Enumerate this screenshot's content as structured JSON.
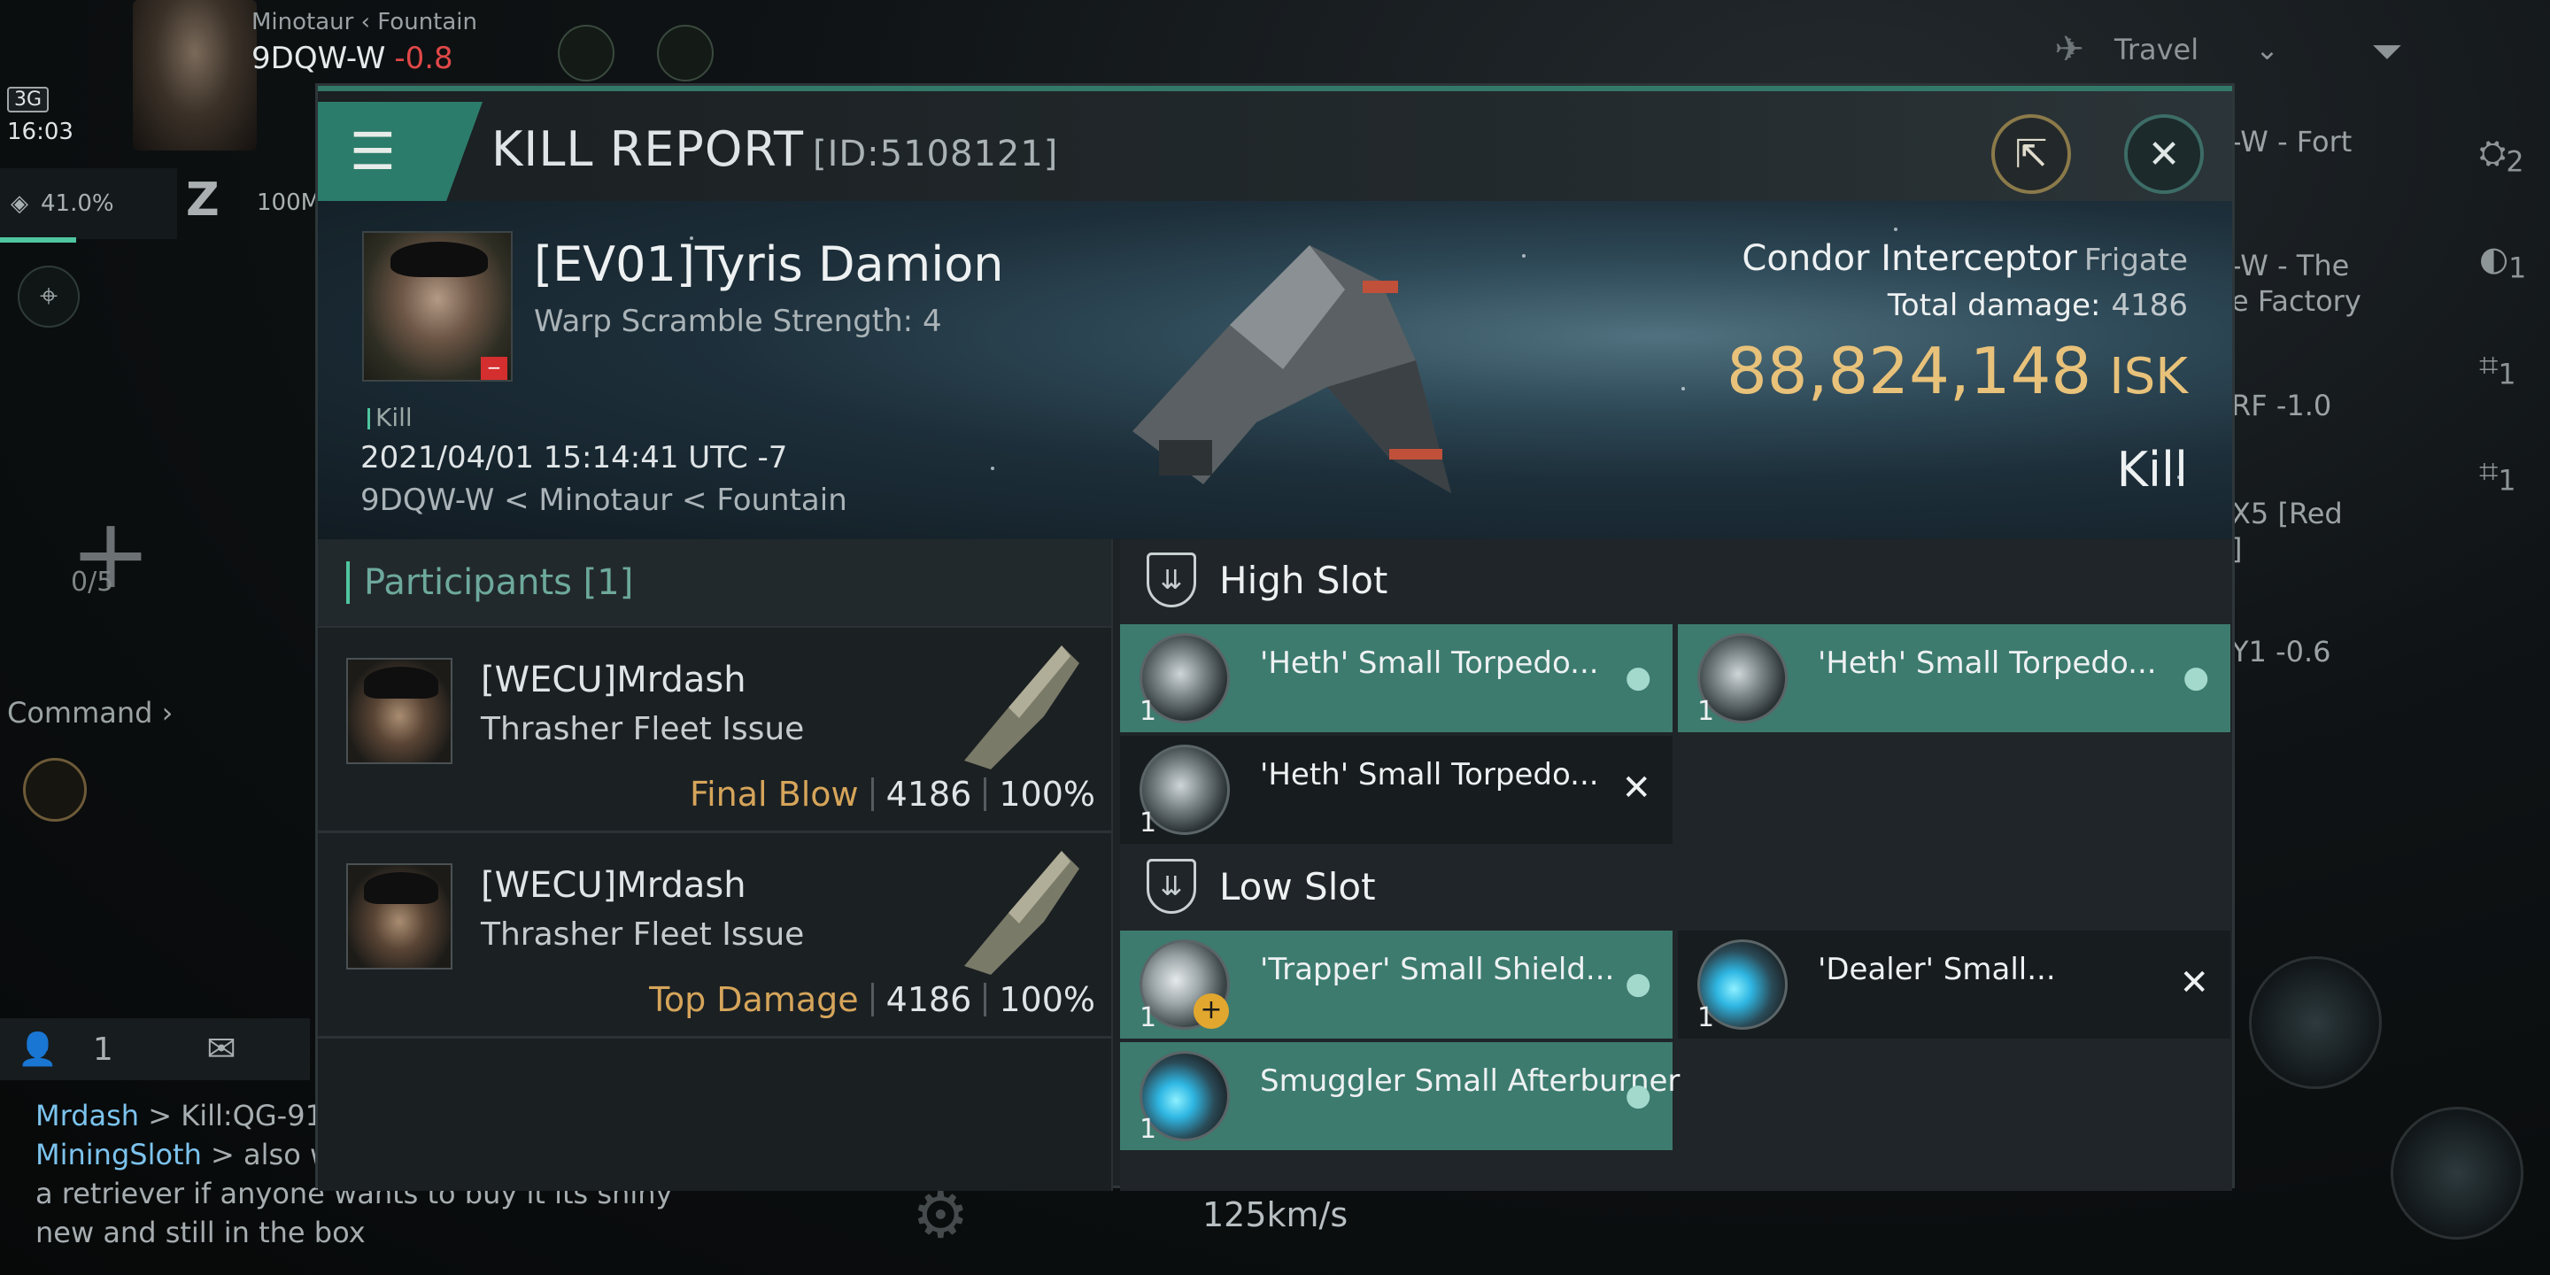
{
  "hud": {
    "system_region": "Minotaur",
    "system_parent": "Fountain",
    "system_name": "9DQW-W",
    "security": "-0.8",
    "signal": "3G",
    "clock": "16:03",
    "cargo_percent": "41.0%",
    "z_value": "100M",
    "travel_label": "Travel",
    "fleet_count": "0/5",
    "command_label": "Command",
    "local_count": "1",
    "speed": "125km/s"
  },
  "right_list": [
    {
      "label": "-W - Fort",
      "badge": "2"
    },
    {
      "label": "-W - The\ne Factory",
      "badge": "1"
    },
    {
      "label": "RF -1.0",
      "badge": "1"
    },
    {
      "label": "X5 [Red\n]",
      "badge": "1"
    },
    {
      "label": "Y1 -0.6",
      "badge": ""
    }
  ],
  "chat": [
    {
      "name": "Mrdash",
      "text": " > Kill:QG-91"
    },
    {
      "name": "MiningSloth",
      "text": " > also w"
    },
    {
      "name": "",
      "text": "a retriever if anyone wants to buy it its shiny"
    },
    {
      "name": "",
      "text": "new and still in the box"
    }
  ],
  "report": {
    "title": "KILL REPORT",
    "id": "[ID:5108121]",
    "victim": {
      "name": "[EV01]Tyris Damion",
      "warp": "Warp Scramble Strength: 4",
      "tag": "Kill",
      "date": "2021/04/01 15:14:41 UTC -7",
      "location": "9DQW-W < Minotaur < Fountain"
    },
    "ship": {
      "name": "Condor Interceptor",
      "class": "Frigate",
      "damage_label": "Total damage:",
      "damage": "4186",
      "isk": "88,824,148",
      "isk_unit": "ISK",
      "result": "Kill"
    },
    "participants_title": "Participants [1]",
    "participants": [
      {
        "name": "[WECU]Mrdash",
        "ship": "Thrasher Fleet Issue",
        "label": "Final Blow",
        "damage": "4186",
        "percent": "100%"
      },
      {
        "name": "[WECU]Mrdash",
        "ship": "Thrasher Fleet Issue",
        "label": "Top Damage",
        "damage": "4186",
        "percent": "100%"
      }
    ],
    "high_slot_label": "High Slot",
    "low_slot_label": "Low Slot",
    "high_slot": [
      {
        "name": "'Heth' Small Torpedo...",
        "qty": "1",
        "status": "dropped",
        "icon": "launcher"
      },
      {
        "name": "'Heth' Small Torpedo...",
        "qty": "1",
        "status": "dropped",
        "icon": "launcher"
      },
      {
        "name": "'Heth' Small Torpedo...",
        "qty": "1",
        "status": "destroyed",
        "icon": "launcher"
      }
    ],
    "low_slot": [
      {
        "name": "'Trapper' Small Shield...",
        "qty": "1",
        "status": "dropped",
        "icon": "shield"
      },
      {
        "name": "'Dealer' Small...",
        "qty": "1",
        "status": "destroyed",
        "icon": "thruster"
      },
      {
        "name": "Smuggler Small Afterburner",
        "qty": "1",
        "status": "dropped",
        "icon": "thruster"
      }
    ],
    "colors": {
      "accent": "#3d7b6f",
      "isk": "#e8c27a",
      "final_blow": "#d6a55a",
      "negative": "#e04848"
    }
  }
}
